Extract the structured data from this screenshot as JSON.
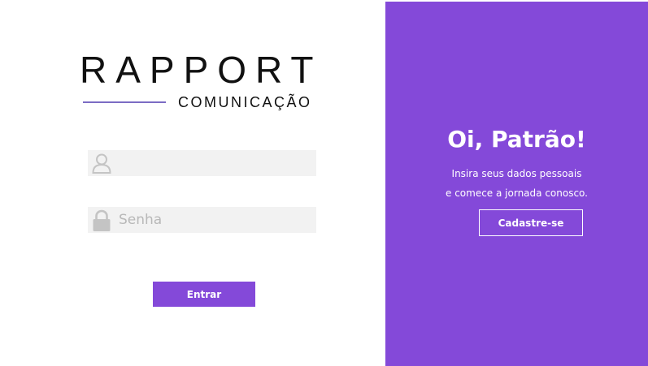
{
  "logo": {
    "wordmark": "RAPPORT",
    "subtitle": "COMUNICAÇÃO"
  },
  "login_form": {
    "username": {
      "value": "",
      "placeholder": "",
      "icon": "user-icon"
    },
    "password": {
      "value": "",
      "placeholder": "Senha",
      "icon": "lock-icon"
    },
    "submit_label": "Entrar"
  },
  "signup_panel": {
    "heading": "Oi, Patrão!",
    "message_line1": "Insira seus dados pessoais",
    "message_line2": "e comece a jornada conosco.",
    "button_label": "Cadastre-se"
  },
  "colors": {
    "accent": "#8449d9",
    "logo_line": "#7b6cc4",
    "field_background": "#f2f2f2",
    "icon_gray": "#c4c4c4"
  }
}
